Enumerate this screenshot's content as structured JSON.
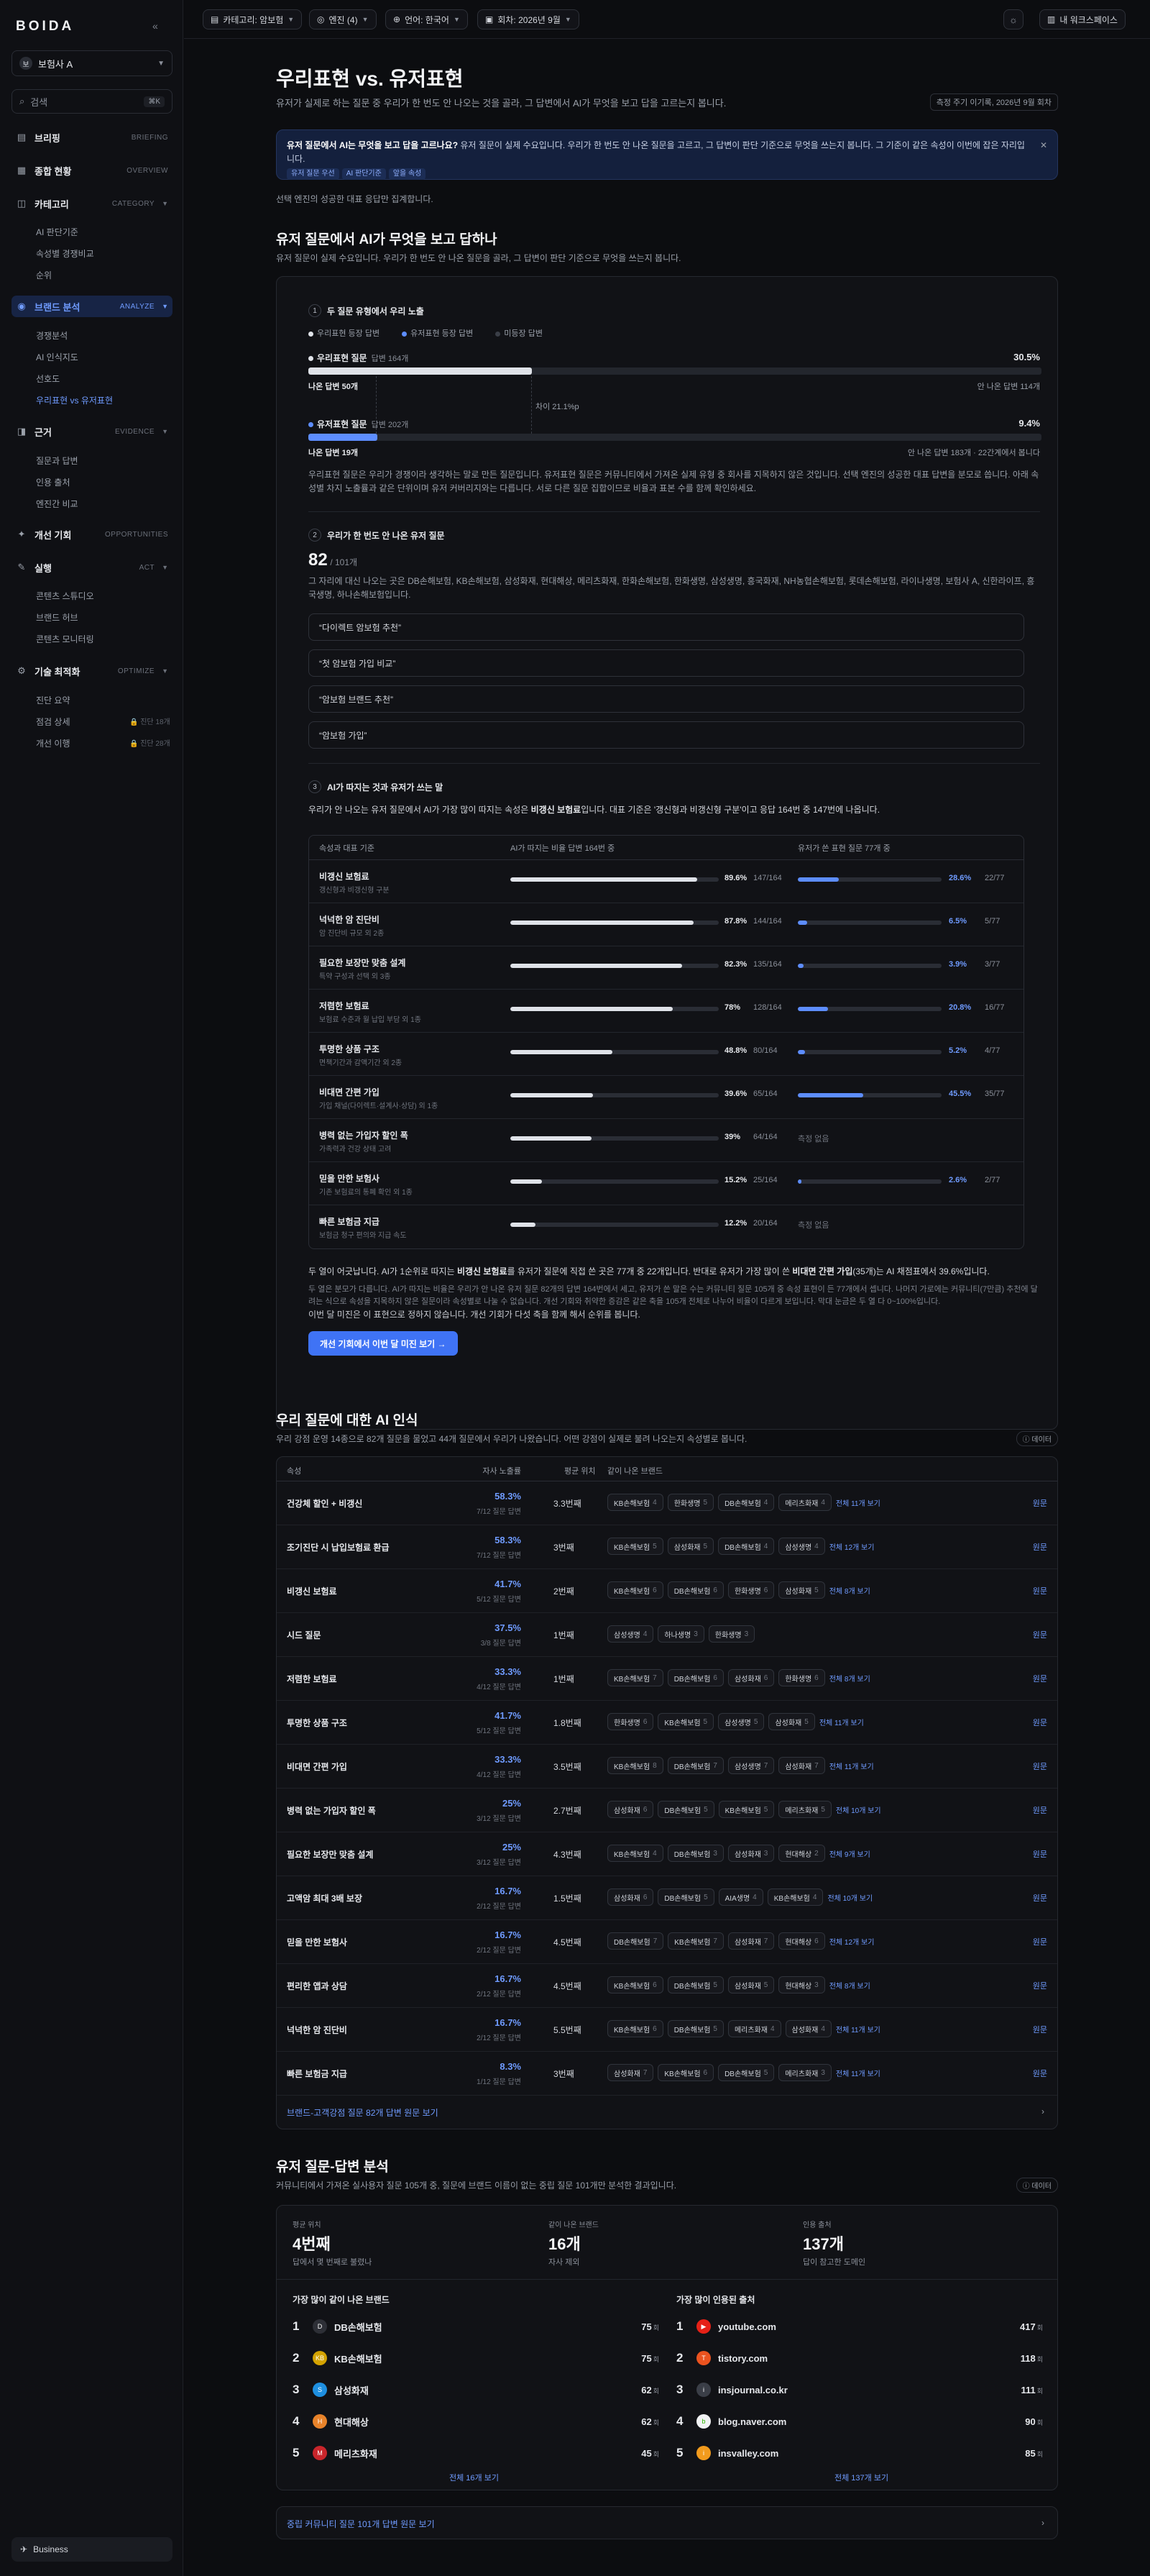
{
  "sidebar": {
    "logo": "BOIDA",
    "org": {
      "avatar": "보",
      "name": "보험사 A"
    },
    "search": {
      "placeholder": "검색",
      "kbd": "⌘K"
    },
    "sections": [
      {
        "label": "브리핑",
        "en": "BRIEFING"
      },
      {
        "label": "종합 현황",
        "en": "OVERVIEW"
      },
      {
        "label": "카테고리",
        "en": "CATEGORY"
      },
      {
        "label": "브랜드 분석",
        "en": "ANALYZE"
      },
      {
        "label": "근거",
        "en": "EVIDENCE"
      },
      {
        "label": "개선 기회",
        "en": "OPPORTUNITIES"
      },
      {
        "label": "실행",
        "en": "ACT"
      },
      {
        "label": "기술 최적화",
        "en": "OPTIMIZE"
      }
    ],
    "category_items": [
      "AI 판단기준",
      "속성별 경쟁비교",
      "순위"
    ],
    "brand_items": [
      "경쟁분석",
      "AI 인식지도",
      "선호도",
      "우리표현 vs 유저표현"
    ],
    "evidence_items": [
      "질문과 답변",
      "인용 출처",
      "엔진간 비교"
    ],
    "act_items": [
      "콘텐츠 스튜디오",
      "브랜드 허브",
      "콘텐츠 모니터링"
    ],
    "optimize_items": [
      "진단 요약",
      "점검 상세",
      "개선 이행"
    ],
    "lock1": "🔒 진단 18개",
    "lock2": "🔒 진단 28개",
    "business": "Business"
  },
  "topbar": {
    "category": "카테고리: 암보험",
    "engine": "엔진 (4)",
    "language": "언어: 한국어",
    "round": "회차: 2026년 9월",
    "workspace": "내 워크스페이스"
  },
  "page": {
    "title": "우리표현 vs. 유저표현",
    "subtitle": "유저가 실제로 하는 질문 중 우리가 한 번도 안 나오는 것을 골라, 그 답변에서 AI가 무엇을 보고 답을 고르는지 봅니다.",
    "measure": "측정 주기 이기록, 2026년 9월 회차",
    "banner_bold": "유저 질문에서 AI는 무엇을 보고 답을 고르나요?",
    "banner_text": " 유저 질문이 실제 수요입니다. 우리가 한 번도 안 나온 질문을 고르고, 그 답변이 판단 기준으로 무엇을 쓰는지 봅니다. 그 기준이 같은 속성이 이번에 잡은 자리입니다.",
    "banner_tags": [
      "유저 질문 우선",
      "AI 판단기준",
      "앞을 속성"
    ],
    "note": "선택 엔진의 성공한 대표 응답만 집계합니다."
  },
  "sec1": {
    "title": "유저 질문에서 AI가 무엇을 보고 답하나",
    "subtitle": "유저 질문이 실제 수요입니다. 우리가 한 번도 안 나온 질문을 골라, 그 답변이 판단 기준으로 무엇을 쓰는지 봅니다.",
    "step1": "두 질문 유형에서 우리 노출",
    "legend": [
      "우리표현 등장 답변",
      "유저표현 등장 답변",
      "미등장 답변"
    ],
    "ours_label": "우리표현 질문",
    "ours_sub": "답변 164개",
    "ours_pct": "30.5%",
    "ours_left": "나온 답변 50개",
    "ours_right": "안 나온 답변 114개",
    "gap": "차이 21.1%p",
    "users_label": "유저표현 질문",
    "users_sub": "답변 202개",
    "users_pct": "9.4%",
    "users_left": "나온 답변 19개",
    "users_right": "안 나온 답변 183개 · 22간계에서 봅니다",
    "para1": "우리표현 질문은 우리가 경쟁이라 생각하는 말로 만든 질문입니다. 유저표현 질문은 커뮤니티에서 가져온 실제 유형 중 회사를 지목하지 않은 것입니다. 선택 엔진의 성공한 대표 답변을 분모로 씁니다. 아래 속성별 차지 노출률과 같은 단위이며 유저 커버리지와는 다릅니다. 서로 다른 질문 집합이므로 비율과 표본 수를 함께 확인하세요.",
    "step2": "우리가 한 번도 안 나온 유저 질문",
    "count": "82",
    "count_total": "/ 101개",
    "para2": "그 자리에 대신 나오는 곳은 DB손해보험, KB손해보험, 삼성화재, 현대해상, 메리츠화재, 한화손해보험, 한화생명, 삼성생명, 흥국화재, NH농협손해보험, 롯데손해보험, 라이나생명, 보험사 A, 신한라이프, 흥국생명, 하나손해보험입니다.",
    "quotes": [
      "“다이렉트 암보험 추천”",
      "“첫 암보험 가입 비교”",
      "“암보험 브랜드 추천”",
      "“암보험 가입”"
    ],
    "step3": "AI가 따지는 것과 유저가 쓰는 말",
    "para3_pre": "우리가 안 나오는 유저 질문에서 AI가 가장 많이 따지는 속성은 ",
    "para3_bold": "비갱신 보험료",
    "para3_post": "입니다. 대표 기준은 '갱신형과 비갱신형 구분'이고 응답 164번 중 147번에 나옵니다.",
    "table_head": [
      "속성과 대표 기준",
      "AI가 따지는 비율  답변 164번 중",
      "유저가 쓴 표현  질문 77개 중"
    ],
    "rows": [
      {
        "name": "비갱신 보험료",
        "desc": "갱신형과 비갱신형 구분",
        "ai": 89.6,
        "ai_c": "147/164",
        "user": 28.6,
        "user_c": "22/77"
      },
      {
        "name": "넉넉한 암 진단비",
        "desc": "암 진단비 규모 외 2종",
        "ai": 87.8,
        "ai_c": "144/164",
        "user": 6.5,
        "user_c": "5/77"
      },
      {
        "name": "필요한 보장만 맞춤 설계",
        "desc": "특약 구성과 선택 외 3종",
        "ai": 82.3,
        "ai_c": "135/164",
        "user": 3.9,
        "user_c": "3/77"
      },
      {
        "name": "저렴한 보험료",
        "desc": "보험료 수준과 월 납입 부담 외 1종",
        "ai": 78.0,
        "ai_c": "128/164",
        "user": 20.8,
        "user_c": "16/77"
      },
      {
        "name": "투명한 상품 구조",
        "desc": "면책기간과 감액기간 외 2종",
        "ai": 48.8,
        "ai_c": "80/164",
        "user": 5.2,
        "user_c": "4/77"
      },
      {
        "name": "비대면 간편 가입",
        "desc": "가입 채널(다이렉트·설계사·상담) 외 1종",
        "ai": 39.6,
        "ai_c": "65/164",
        "user": 45.5,
        "user_c": "35/77"
      },
      {
        "name": "병력 없는 가입자 할인 폭",
        "desc": "가족력과 건강 상태 고려",
        "ai": 39.0,
        "ai_c": "64/164",
        "user": null,
        "user_c": "측정 없음"
      },
      {
        "name": "믿을 만한 보험사",
        "desc": "기존 보험료의 통폐 확인 외 1종",
        "ai": 15.2,
        "ai_c": "25/164",
        "user": 2.6,
        "user_c": "2/77"
      },
      {
        "name": "빠른 보험금 지급",
        "desc": "보험금 청구 편의와 지급 속도",
        "ai": 12.2,
        "ai_c": "20/164",
        "user": null,
        "user_c": "측정 없음"
      }
    ],
    "para4_pre": "두 열이 어긋납니다. AI가 1순위로 따지는 ",
    "para4_b1": "비갱신 보험료",
    "para4_mid": "를 유저가 질문에 직접 쓴 곳은 77개 중 22개입니다. 반대로 유저가 가장 많이 쓴 ",
    "para4_b2": "비대면 간편 가입",
    "para4_post": "(35개)는 AI 채점표에서 39.6%입니다.",
    "para5": "두 열은 분모가 다릅니다. AI가 따지는 비율은 우리가 안 나온 유저 질문 82개의 답변 164번에서 세고, 유저가 쓴 말은 수는 커뮤니티 질문 105개 중 속성 표현이 든 77개에서 셉니다. 나머지 가로에는 커뮤니티(7만큼) 추천에 달려는 식으로 속성을 지목하지 않은 질문이라 속성별로 나눌 수 없습니다. 개선 기회와 취약한 증감은 같은 축을 105개 전체로 나누어 비율이 다르게 보입니다. 막대 눈금은 두 열 다 0~100%입니다.",
    "para6": "이번 달 미진은 이 표현으로 정하지 않습니다. 개선 기회가 다섯 축을 함께 해서 순위를 봅니다.",
    "cta": "개선 기회에서 이번 달 미진 보기 →"
  },
  "sec2": {
    "title": "우리 질문에 대한 AI 인식",
    "subtitle": "우리 강점 운영 14종으로 82개 질문을 물었고 44개 질문에서 우리가 나왔습니다. 어떤 강점이 실제로 불려 나오는지 속성별로 봅니다.",
    "datatag": "ⓘ 데이터",
    "head": [
      "속성",
      "자사 노출률",
      "평균 위치",
      "같이 나온 브랜드"
    ],
    "view": "원문",
    "rows": [
      {
        "attr": "건강체 할인 + 비갱신",
        "pct": "58.3%",
        "sub": "7/12 질문 답변",
        "rank": "3.3번째",
        "chips": [
          [
            "KB손해보험",
            "4"
          ],
          [
            "한화생명",
            "5"
          ],
          [
            "DB손해보험",
            "4"
          ],
          [
            "메리츠화재",
            "4"
          ]
        ],
        "more": "전체 11개 보기"
      },
      {
        "attr": "조기진단 시 납입보험료 환급",
        "pct": "58.3%",
        "sub": "7/12 질문 답변",
        "rank": "3번째",
        "chips": [
          [
            "KB손해보험",
            "5"
          ],
          [
            "삼성화재",
            "5"
          ],
          [
            "DB손해보험",
            "4"
          ],
          [
            "삼성생명",
            "4"
          ]
        ],
        "more": "전체 12개 보기"
      },
      {
        "attr": "비갱신 보험료",
        "pct": "41.7%",
        "sub": "5/12 질문 답변",
        "rank": "2번째",
        "chips": [
          [
            "KB손해보험",
            "6"
          ],
          [
            "DB손해보험",
            "6"
          ],
          [
            "한화생명",
            "6"
          ],
          [
            "삼성화재",
            "5"
          ]
        ],
        "more": "전체 8개 보기"
      },
      {
        "attr": "시드 질문",
        "pct": "37.5%",
        "sub": "3/8 질문 답변",
        "rank": "1번째",
        "chips": [
          [
            "삼성생명",
            "4"
          ],
          [
            "하나생명",
            "3"
          ],
          [
            "한화생명",
            "3"
          ]
        ],
        "more": ""
      },
      {
        "attr": "저렴한 보험료",
        "pct": "33.3%",
        "sub": "4/12 질문 답변",
        "rank": "1번째",
        "chips": [
          [
            "KB손해보험",
            "7"
          ],
          [
            "DB손해보험",
            "6"
          ],
          [
            "삼성화재",
            "6"
          ],
          [
            "한화생명",
            "6"
          ]
        ],
        "more": "전체 8개 보기"
      },
      {
        "attr": "투명한 상품 구조",
        "pct": "41.7%",
        "sub": "5/12 질문 답변",
        "rank": "1.8번째",
        "chips": [
          [
            "한화생명",
            "6"
          ],
          [
            "KB손해보험",
            "5"
          ],
          [
            "삼성생명",
            "5"
          ],
          [
            "삼성화재",
            "5"
          ]
        ],
        "more": "전체 11개 보기"
      },
      {
        "attr": "비대면 간편 가입",
        "pct": "33.3%",
        "sub": "4/12 질문 답변",
        "rank": "3.5번째",
        "chips": [
          [
            "KB손해보험",
            "8"
          ],
          [
            "DB손해보험",
            "7"
          ],
          [
            "삼성생명",
            "7"
          ],
          [
            "삼성화재",
            "7"
          ]
        ],
        "more": "전체 11개 보기"
      },
      {
        "attr": "병력 없는 가입자 할인 폭",
        "pct": "25%",
        "sub": "3/12 질문 답변",
        "rank": "2.7번째",
        "chips": [
          [
            "삼성화재",
            "6"
          ],
          [
            "DB손해보험",
            "5"
          ],
          [
            "KB손해보험",
            "5"
          ],
          [
            "메리츠화재",
            "5"
          ]
        ],
        "more": "전체 10개 보기"
      },
      {
        "attr": "필요한 보장만 맞춤 설계",
        "pct": "25%",
        "sub": "3/12 질문 답변",
        "rank": "4.3번째",
        "chips": [
          [
            "KB손해보험",
            "4"
          ],
          [
            "DB손해보험",
            "3"
          ],
          [
            "삼성화재",
            "3"
          ],
          [
            "현대해상",
            "2"
          ]
        ],
        "more": "전체 9개 보기"
      },
      {
        "attr": "고액암 최대 3배 보장",
        "pct": "16.7%",
        "sub": "2/12 질문 답변",
        "rank": "1.5번째",
        "chips": [
          [
            "삼성화재",
            "6"
          ],
          [
            "DB손해보험",
            "5"
          ],
          [
            "AIA생명",
            "4"
          ],
          [
            "KB손해보험",
            "4"
          ]
        ],
        "more": "전체 10개 보기"
      },
      {
        "attr": "믿을 만한 보험사",
        "pct": "16.7%",
        "sub": "2/12 질문 답변",
        "rank": "4.5번째",
        "chips": [
          [
            "DB손해보험",
            "7"
          ],
          [
            "KB손해보험",
            "7"
          ],
          [
            "삼성화재",
            "7"
          ],
          [
            "현대해상",
            "6"
          ]
        ],
        "more": "전체 12개 보기"
      },
      {
        "attr": "편리한 앱과 상담",
        "pct": "16.7%",
        "sub": "2/12 질문 답변",
        "rank": "4.5번째",
        "chips": [
          [
            "KB손해보험",
            "6"
          ],
          [
            "DB손해보험",
            "5"
          ],
          [
            "삼성화재",
            "5"
          ],
          [
            "현대해상",
            "3"
          ]
        ],
        "more": "전체 8개 보기"
      },
      {
        "attr": "넉넉한 암 진단비",
        "pct": "16.7%",
        "sub": "2/12 질문 답변",
        "rank": "5.5번째",
        "chips": [
          [
            "KB손해보험",
            "6"
          ],
          [
            "DB손해보험",
            "5"
          ],
          [
            "메리츠화재",
            "4"
          ],
          [
            "삼성화재",
            "4"
          ]
        ],
        "more": "전체 11개 보기"
      },
      {
        "attr": "빠른 보험금 지급",
        "pct": "8.3%",
        "sub": "1/12 질문 답변",
        "rank": "3번째",
        "chips": [
          [
            "삼성화재",
            "7"
          ],
          [
            "KB손해보험",
            "6"
          ],
          [
            "DB손해보험",
            "5"
          ],
          [
            "메리츠화재",
            "3"
          ]
        ],
        "more": "전체 11개 보기"
      }
    ],
    "foot": "브랜드-고객강점 질문 82개 답변 원문 보기"
  },
  "sec3": {
    "title": "유저 질문-답변 분석",
    "subtitle": "커뮤니티에서 가져온 실사용자 질문 105개 중, 질문에 브랜드 이름이 없는 중립 질문 101개만 분석한 결과입니다.",
    "datatag": "ⓘ 데이터",
    "stats": [
      {
        "label": "평균 위치",
        "value": "4번째",
        "sub": "답에서 몇 번째로 불렸나"
      },
      {
        "label": "같이 나온 브랜드",
        "value": "16개",
        "sub": "자사 제외"
      },
      {
        "label": "인용 출처",
        "value": "137개",
        "sub": "답이 참고한 도메인"
      }
    ],
    "brands_title": "가장 많이 같이 나온 브랜드",
    "brands": [
      {
        "rank": "1",
        "name": "DB손해보험",
        "count": "75",
        "logo": "D",
        "color": "#2d2f36"
      },
      {
        "rank": "2",
        "name": "KB손해보험",
        "count": "75",
        "logo": "KB",
        "color": "#d4a300"
      },
      {
        "rank": "3",
        "name": "삼성화재",
        "count": "62",
        "logo": "S",
        "color": "#1e8fe0"
      },
      {
        "rank": "4",
        "name": "현대해상",
        "count": "62",
        "logo": "H",
        "color": "#e8832a"
      },
      {
        "rank": "5",
        "name": "메리츠화재",
        "count": "45",
        "logo": "M",
        "color": "#c9252b"
      }
    ],
    "brands_more": "전체 16개 보기",
    "sources_title": "가장 많이 인용된 출처",
    "sources": [
      {
        "rank": "1",
        "name": "youtube.com",
        "count": "417",
        "logo": "▶",
        "color": "#e62117"
      },
      {
        "rank": "2",
        "name": "tistory.com",
        "count": "118",
        "logo": "T",
        "color": "#eb531f"
      },
      {
        "rank": "3",
        "name": "insjournal.co.kr",
        "count": "111",
        "logo": "i",
        "color": "#3a3e47"
      },
      {
        "rank": "4",
        "name": "blog.naver.com",
        "count": "90",
        "logo": "b",
        "color": "#f1f2f4"
      },
      {
        "rank": "5",
        "name": "insvalley.com",
        "count": "85",
        "logo": "i",
        "color": "#f29b1d"
      }
    ],
    "sources_more": "전체 137개 보기",
    "count_unit": "회",
    "foot": "중립 커뮤니티 질문 101개 답변 원문 보기"
  }
}
